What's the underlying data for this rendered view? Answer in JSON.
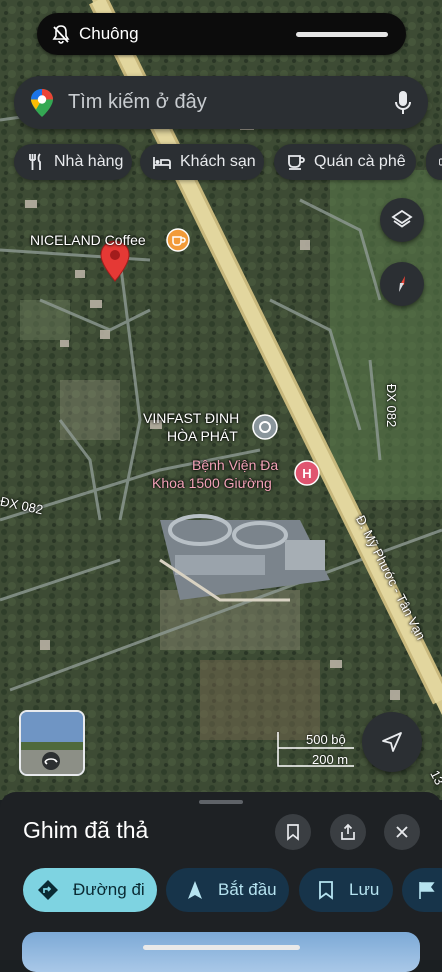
{
  "status": {
    "silent_label": "Chuông"
  },
  "search": {
    "placeholder": "Tìm kiếm ở đây"
  },
  "chips": [
    {
      "label": "Nhà hàng",
      "icon": "restaurant-icon"
    },
    {
      "label": "Khách sạn",
      "icon": "hotel-icon"
    },
    {
      "label": "Quán cà phê",
      "icon": "cafe-icon"
    }
  ],
  "map": {
    "poi_niceland": "NICELAND Coffee",
    "poi_vinfast_1": "VINFAST ĐỊNH",
    "poi_vinfast_2": "HÒA PHÁT",
    "poi_hospital_1": "Bệnh Viện Đa",
    "poi_hospital_2": "Khoa 1500 Giường",
    "road_dx082_v": "ĐX 082",
    "road_dx082_h": "ĐX 082",
    "road_myphuoc": "Đ. Mỹ Phước - Tân Vạn",
    "road_13": "13",
    "scale_ft": "500 bộ",
    "scale_m": "200 m"
  },
  "sheet": {
    "title": "Ghim đã thả",
    "directions": "Đường đi",
    "start": "Bắt đầu",
    "save": "Lưu"
  },
  "colors": {
    "accent": "#7ed3e1",
    "pin": "#e53935",
    "hospital": "#e05570",
    "cafe": "#f29b38"
  }
}
